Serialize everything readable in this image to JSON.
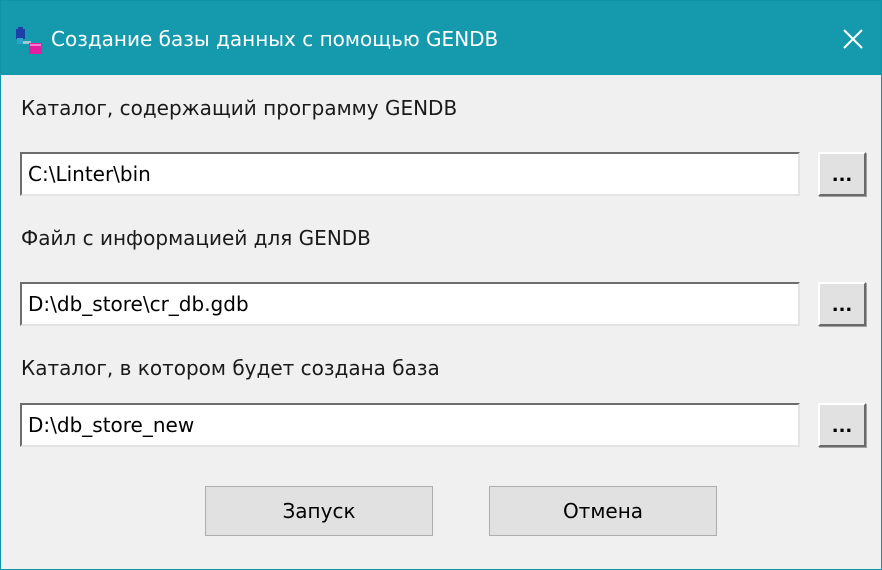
{
  "window": {
    "title": "Создание базы данных с помощью GENDB",
    "close_symbol": "✕",
    "app_icon": "database-app-icon"
  },
  "form": {
    "fields": [
      {
        "label": "Каталог, содержащий программу GENDB",
        "value": "C:\\Linter\\bin",
        "browse_label": "..."
      },
      {
        "label": "Файл с информацией для GENDB",
        "value": "D:\\db_store\\cr_db.gdb",
        "browse_label": "..."
      },
      {
        "label": "Каталог, в котором будет создана база",
        "value": "D:\\db_store_new",
        "browse_label": "..."
      }
    ]
  },
  "buttons": {
    "run_label": "Запуск",
    "cancel_label": "Отмена"
  },
  "colors": {
    "titlebar": "#1599ad",
    "window_bg": "#f0f0f0",
    "button_bg": "#e1e1e1"
  }
}
